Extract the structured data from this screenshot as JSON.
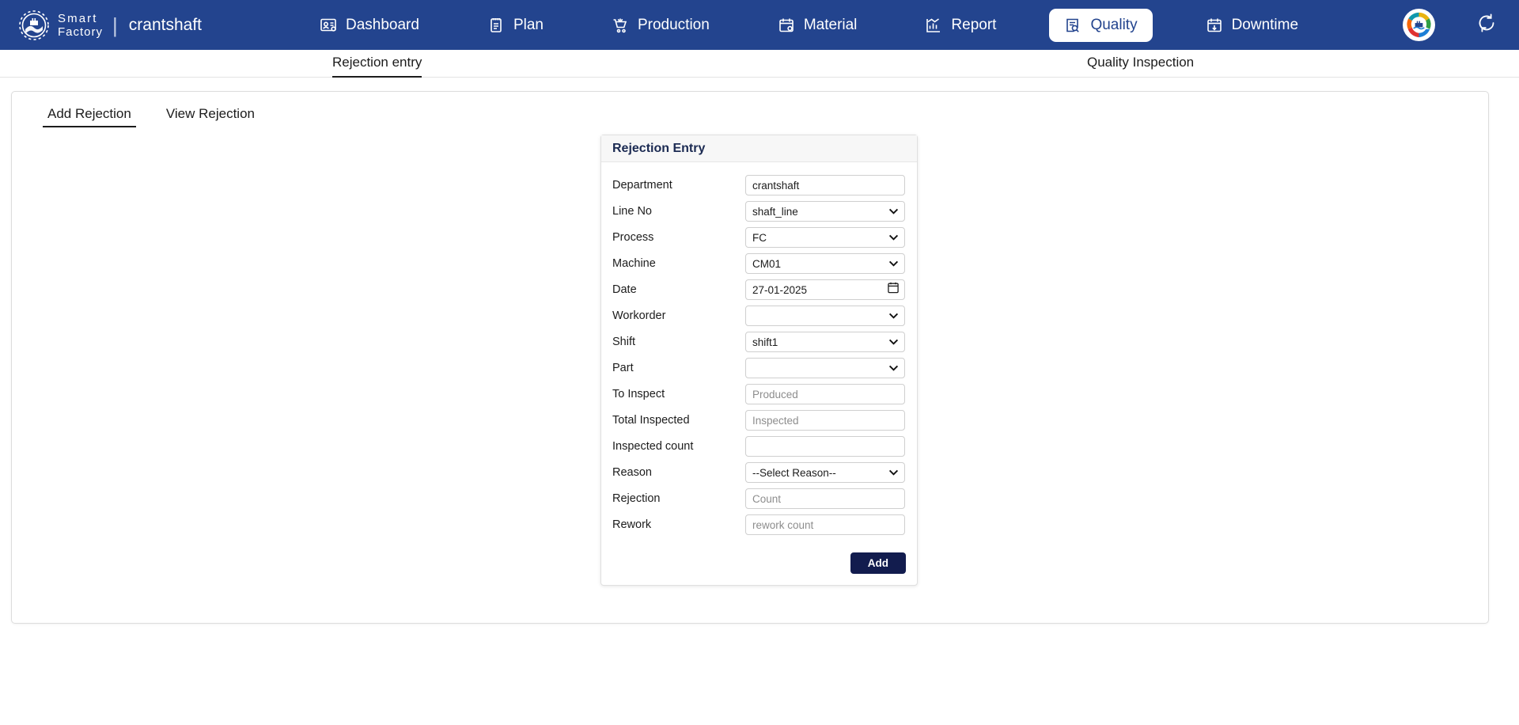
{
  "navbar": {
    "brand_line1": "Smart",
    "brand_line2": "Factory",
    "separator": "|",
    "department": "crantshaft",
    "accent_color": "#23448e",
    "items": [
      {
        "label": "Dashboard",
        "icon": "dashboard-icon",
        "active": false
      },
      {
        "label": "Plan",
        "icon": "clipboard-icon",
        "active": false
      },
      {
        "label": "Production",
        "icon": "cart-icon",
        "active": false
      },
      {
        "label": "Material",
        "icon": "calendar-gear-icon",
        "active": false
      },
      {
        "label": "Report",
        "icon": "bar-chart-icon",
        "active": false
      },
      {
        "label": "Quality",
        "icon": "document-search-icon",
        "active": true
      },
      {
        "label": "Downtime",
        "icon": "calendar-down-icon",
        "active": false
      }
    ],
    "avatar_icon": "company-logo-avatar",
    "refresh_icon": "refresh-history-icon"
  },
  "subnav": {
    "items": [
      {
        "label": "Rejection entry",
        "active": true
      },
      {
        "label": "Quality Inspection",
        "active": false
      }
    ]
  },
  "tabs": [
    {
      "label": "Add Rejection",
      "active": true
    },
    {
      "label": "View Rejection",
      "active": false
    }
  ],
  "form": {
    "title": "Rejection Entry",
    "submit_label": "Add",
    "submit_color": "#121c4e",
    "fields": [
      {
        "label": "Department",
        "type": "text",
        "value": "crantshaft",
        "placeholder": ""
      },
      {
        "label": "Line No",
        "type": "select",
        "value": "shaft_line",
        "placeholder": ""
      },
      {
        "label": "Process",
        "type": "select",
        "value": "FC",
        "placeholder": ""
      },
      {
        "label": "Machine",
        "type": "select",
        "value": "CM01",
        "placeholder": ""
      },
      {
        "label": "Date",
        "type": "date",
        "value": "27-01-2025",
        "placeholder": ""
      },
      {
        "label": "Workorder",
        "type": "select",
        "value": "",
        "placeholder": ""
      },
      {
        "label": "Shift",
        "type": "select",
        "value": "shift1",
        "placeholder": ""
      },
      {
        "label": "Part",
        "type": "select",
        "value": "",
        "placeholder": ""
      },
      {
        "label": "To Inspect",
        "type": "text",
        "value": "",
        "placeholder": "Produced"
      },
      {
        "label": "Total Inspected",
        "type": "text",
        "value": "",
        "placeholder": "Inspected"
      },
      {
        "label": "Inspected count",
        "type": "text",
        "value": "",
        "placeholder": ""
      },
      {
        "label": "Reason",
        "type": "select",
        "value": "--Select Reason--",
        "placeholder": ""
      },
      {
        "label": "Rejection",
        "type": "text",
        "value": "",
        "placeholder": "Count"
      },
      {
        "label": "Rework",
        "type": "text",
        "value": "",
        "placeholder": "rework count"
      }
    ]
  }
}
